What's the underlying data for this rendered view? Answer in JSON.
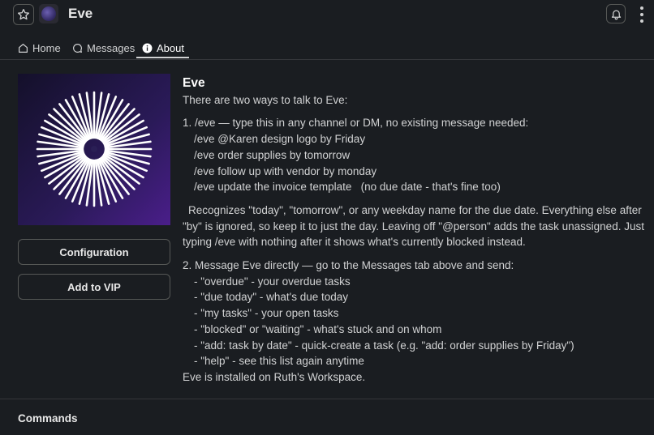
{
  "header": {
    "title": "Eve",
    "icons": {
      "star": "star-icon",
      "bell": "bell-icon",
      "more": "more-vertical-icon"
    }
  },
  "tabs": [
    {
      "label": "Home",
      "icon": "home-icon"
    },
    {
      "label": "Messages",
      "icon": "message-bubble-icon"
    },
    {
      "label": "About",
      "icon": "info-icon",
      "active": true
    }
  ],
  "sidebar": {
    "configuration_label": "Configuration",
    "vip_label": "Add to VIP"
  },
  "about": {
    "title": "Eve",
    "intro": "There are two ways to talk to Eve:",
    "option1_heading": "1. /eve — type this in any channel or DM, no existing message needed:",
    "option1_examples": [
      "/eve @Karen design logo by Friday",
      "/eve order supplies by tomorrow",
      "/eve follow up with vendor by monday",
      "/eve update the invoice template   (no due date - that's fine too)"
    ],
    "option1_note": "Recognizes \"today\", \"tomorrow\", or any weekday name for the due date. Everything else after \"by\" is ignored, so keep it to just the day. Leaving off \"@person\" adds the task unassigned. Just typing /eve with nothing after it shows what's currently blocked instead.",
    "option2_heading": "2. Message Eve directly — go to the Messages tab above and send:",
    "option2_items": [
      "- \"overdue\" - your overdue tasks",
      "- \"due today\" - what's due today",
      "- \"my tasks\" - your open tasks",
      "- \"blocked\" or \"waiting\" - what's stuck and on whom",
      "- \"add: task by date\" - quick-create a task (e.g. \"add: order supplies by Friday\")",
      "- \"help\" - see this list again anytime"
    ],
    "installed": "Eve is installed on Ruth's Workspace."
  },
  "section": {
    "commands": "Commands"
  },
  "colors": {
    "background": "#1a1d21",
    "text": "#d1d2d3",
    "border": "#565856",
    "image_gradient_end": "#4a1e8a"
  }
}
